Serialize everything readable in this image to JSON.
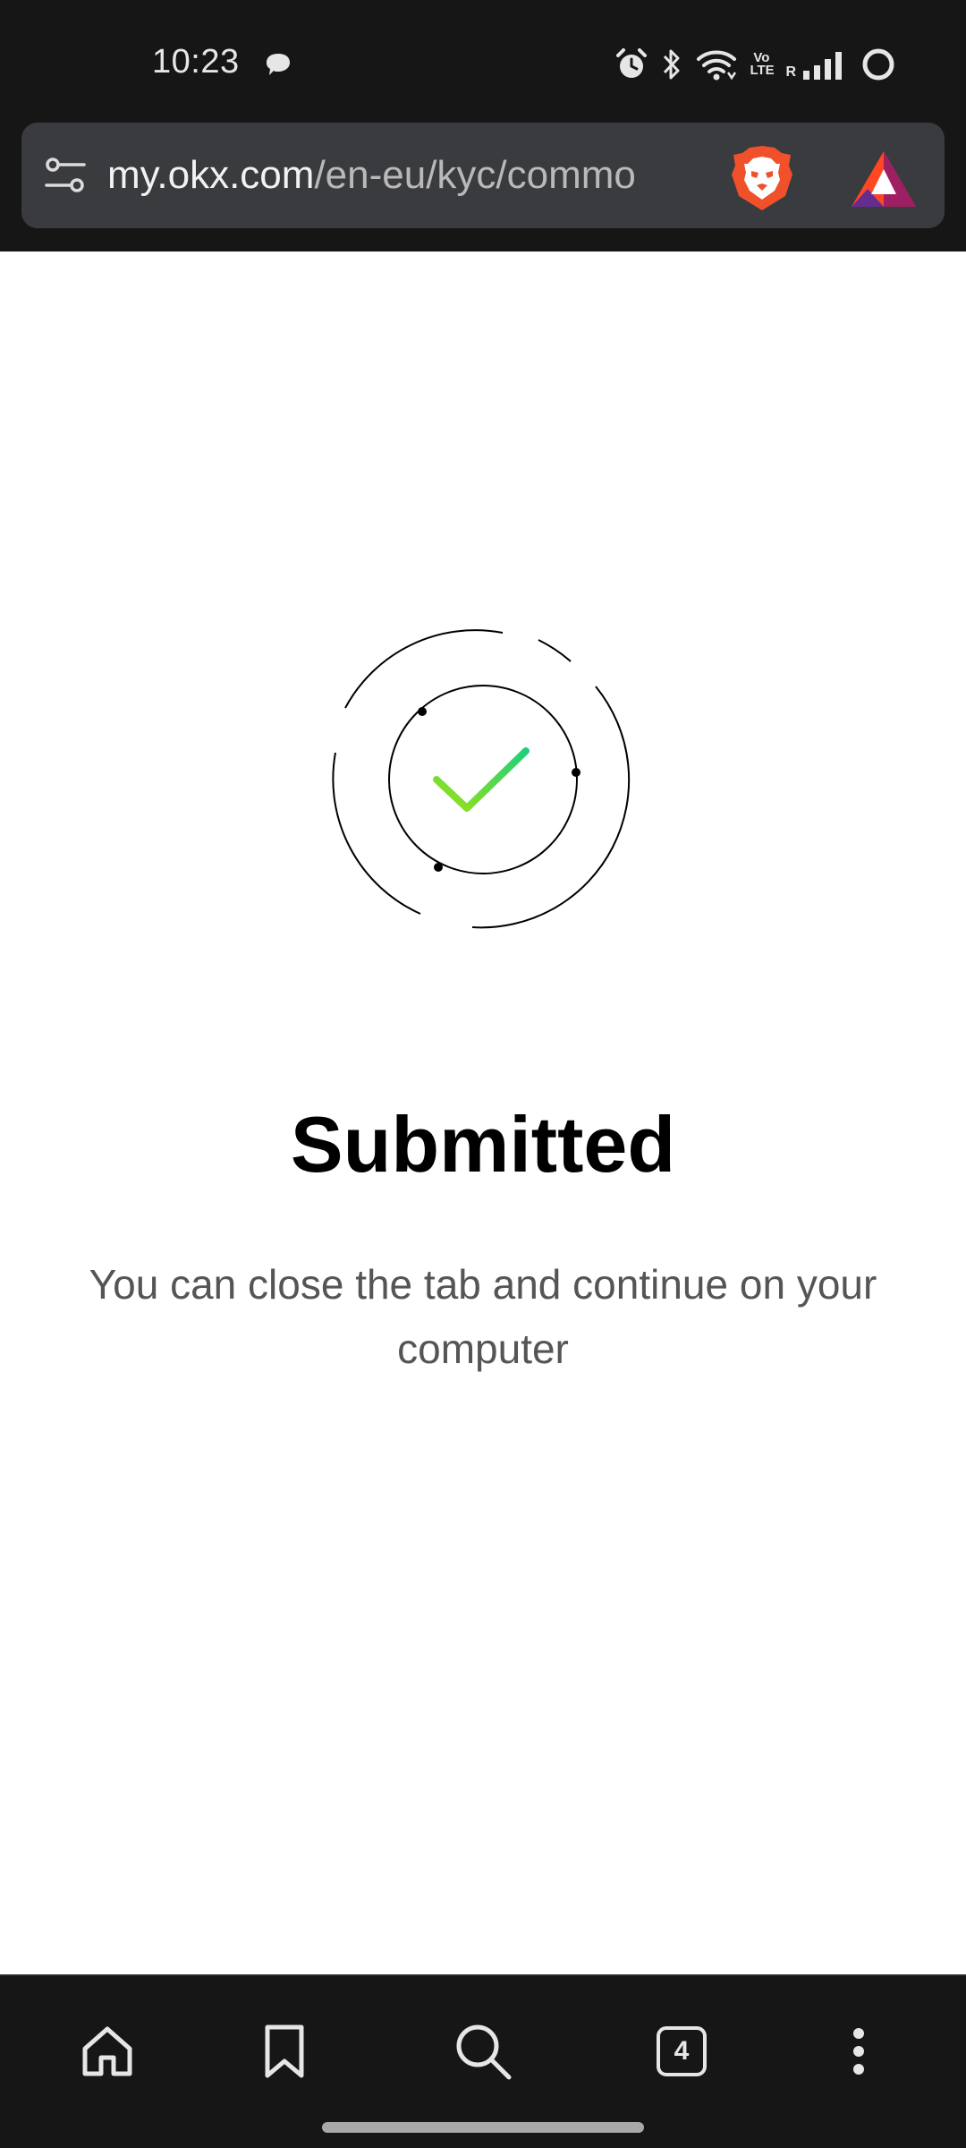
{
  "status_bar": {
    "time": "10:23",
    "volte_label": "Vo LTE",
    "roaming_label": "R",
    "icons": [
      "chat-bubble-icon",
      "alarm-icon",
      "bluetooth-icon",
      "wifi-icon",
      "signal-icon",
      "battery-ring-icon"
    ]
  },
  "browser": {
    "url_host": "my.okx.com",
    "url_path": "/en-eu/kyc/commo",
    "icons": [
      "site-settings-icon",
      "brave-shields-icon",
      "brave-rewards-icon"
    ]
  },
  "main": {
    "title": "Submitted",
    "message": "You can close the tab and continue on your computer",
    "check_colors": [
      "#9be21a",
      "#1fcf7a"
    ]
  },
  "bottom_nav": {
    "tab_count": "4",
    "items": [
      "home-icon",
      "bookmark-icon",
      "search-icon",
      "tabs-icon",
      "more-icon"
    ]
  }
}
